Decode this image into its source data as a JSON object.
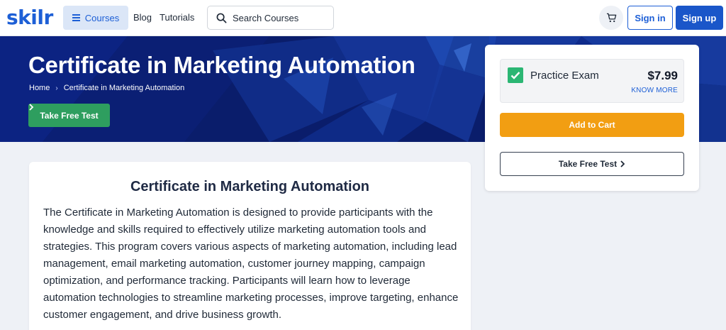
{
  "nav": {
    "logo": "skilr",
    "courses_label": "Courses",
    "blog_label": "Blog",
    "tutorials_label": "Tutorials",
    "search_placeholder": "Search Courses",
    "cart_icon": "cart-icon",
    "signin_label": "Sign in",
    "signup_label": "Sign up"
  },
  "hero": {
    "title": "Certificate in Marketing Automation",
    "breadcrumb": [
      "Home",
      "Certificate in Marketing Automation"
    ],
    "take_free_label": "Take Free Test"
  },
  "side_card": {
    "option_label": "Practice Exam",
    "price": "$7.99",
    "know_more": "KNOW MORE",
    "add_to_cart": "Add to Cart",
    "take_free_label": "Take Free Test"
  },
  "content": {
    "title": "Certificate in Marketing Automation",
    "description": "The Certificate in Marketing Automation is designed to provide participants with the knowledge and skills required to effectively utilize marketing automation tools and strategies. This program covers various aspects of marketing automation, including lead management, email marketing automation, customer journey mapping, campaign optimization, and performance tracking. Participants will learn how to leverage automation technologies to streamline marketing processes, improve targeting, enhance customer engagement, and drive business growth."
  },
  "colors": {
    "brand": "#1d5fd6",
    "hero_bg": "#0a1d6b",
    "green": "#2e9e5f",
    "orange": "#f29e12"
  }
}
